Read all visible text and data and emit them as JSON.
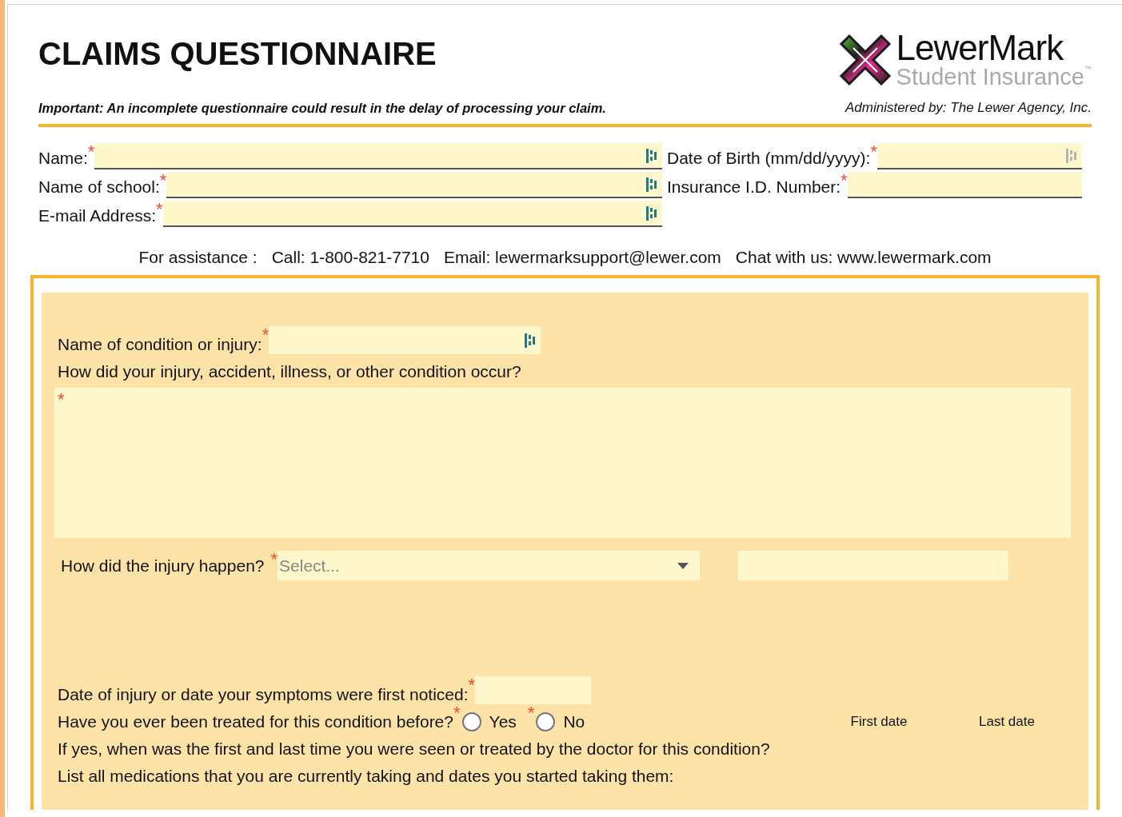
{
  "header": {
    "title": "CLAIMS QUESTIONNAIRE",
    "notice": "Important: An incomplete questionnaire could result in the delay of processing your claim.",
    "logo": {
      "name": "LewerMark",
      "tagline": "Student Insurance",
      "trademark": "™"
    },
    "administered": "Administered by: The Lewer Agency, Inc."
  },
  "personal_fields": {
    "left": [
      {
        "label": "Name:",
        "mark": "*"
      },
      {
        "label": "Name of school:",
        "mark": "*"
      },
      {
        "label": "E-mail Address:",
        "mark": "*"
      }
    ],
    "right": [
      {
        "label": "Date of Birth (mm/dd/yyyy):",
        "mark": "*"
      },
      {
        "label": "Insurance I.D. Number:",
        "mark": "*"
      }
    ]
  },
  "assistance": [
    "For assistance :",
    "Call: 1-800-821-7710",
    "Email: lewermarksupport@lewer.com",
    "Chat with us: www.lewermark.com"
  ],
  "claim_section": [
    {
      "kind": "text-field",
      "label": "Name of condition or injury:",
      "mark": "*"
    },
    {
      "kind": "question",
      "text": "How did your injury, accident, illness, or other condition occur?"
    },
    {
      "kind": "textarea",
      "mark": "*"
    },
    {
      "kind": "select",
      "label": "How did the injury happen?",
      "mark": "*",
      "placeholder": "Select..."
    },
    {
      "kind": "short-field",
      "label": "Date of injury or date your symptoms were first noticed:",
      "mark": "*"
    },
    {
      "kind": "radio",
      "label": "Have you ever been treated for this condition before?",
      "options": [
        {
          "label": "Yes",
          "mark": "*",
          "selected": false
        },
        {
          "label": "No",
          "mark": "*",
          "selected": false
        }
      ],
      "columns": [
        "First date",
        "Last date"
      ]
    },
    {
      "kind": "question",
      "text": "If yes, when was the first and last time you were seen or treated by the doctor for this condition?"
    },
    {
      "kind": "question",
      "text": "List all medications that you are currently taking and dates you started taking them:"
    }
  ]
}
